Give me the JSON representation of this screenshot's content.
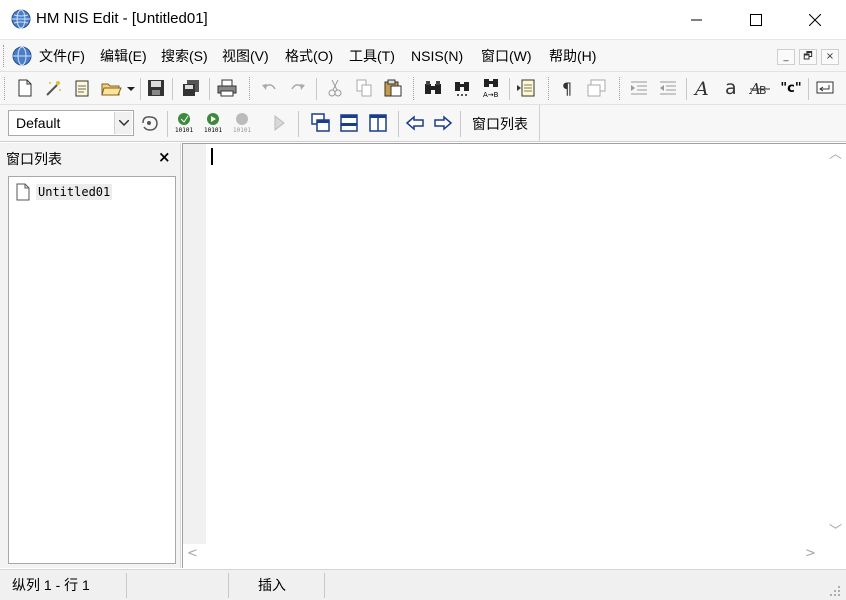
{
  "window": {
    "title": "HM NIS Edit - [Untitled01]",
    "icon": "globe-app-icon",
    "controls": [
      "minimize-icon",
      "maximize-icon",
      "close-icon"
    ]
  },
  "menubar": {
    "items": [
      {
        "label": "文件(F)"
      },
      {
        "label": "编辑(E)"
      },
      {
        "label": "搜索(S)"
      },
      {
        "label": "视图(V)"
      },
      {
        "label": "格式(O)"
      },
      {
        "label": "工具(T)"
      },
      {
        "label": "NSIS(N)"
      },
      {
        "label": "窗口(W)"
      },
      {
        "label": "帮助(H)"
      }
    ],
    "mdi_controls": [
      "_",
      "🗗",
      "×"
    ]
  },
  "toolbar1": {
    "buttons": [
      "new-file-icon",
      "wizard-icon",
      "template-icon",
      "open-folder-icon",
      "save-icon",
      "save-all-icon",
      "print-icon",
      "undo-icon",
      "redo-icon",
      "cut-icon",
      "copy-icon",
      "paste-icon",
      "find-icon",
      "find-next-icon",
      "replace-icon",
      "goto-line-icon",
      "pilcrow-icon",
      "word-wrap-icon",
      "indent-icon",
      "outdent-icon",
      "uppercase-icon",
      "lowercase-icon",
      "toggle-case-icon",
      "quote-icon",
      "line-break-icon"
    ],
    "quote_text": "\"c\""
  },
  "toolbar2": {
    "language_select": "Default",
    "winlist_label": "窗口列表",
    "buttons": [
      "macro-icon",
      "compile-icon",
      "compile-run-icon",
      "stop-compile-icon",
      "run-icon",
      "cascade-icon",
      "tile-horizontal-icon",
      "tile-vertical-icon",
      "prev-window-icon",
      "next-window-icon"
    ]
  },
  "sidepanel": {
    "title": "窗口列表",
    "close": "×",
    "items": [
      {
        "label": "Untitled01"
      }
    ]
  },
  "statusbar": {
    "position": "纵列 1 - 行 1",
    "mode": "插入"
  }
}
